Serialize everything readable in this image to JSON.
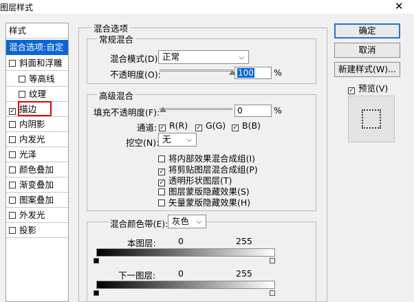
{
  "window": {
    "title": "图层样式",
    "close_glyph": "✕"
  },
  "left_list": [
    {
      "label": "样式",
      "type": "header"
    },
    {
      "label": "混合选项:自定",
      "type": "selected"
    },
    {
      "label": "斜面和浮雕",
      "check": false,
      "indent": false
    },
    {
      "label": "等高线",
      "check": false,
      "indent": true
    },
    {
      "label": "纹理",
      "check": false,
      "indent": true
    },
    {
      "label": "描边",
      "check": true,
      "indent": false
    },
    {
      "label": "内阴影",
      "check": false,
      "indent": false
    },
    {
      "label": "内发光",
      "check": false,
      "indent": false
    },
    {
      "label": "光泽",
      "check": false,
      "indent": false
    },
    {
      "label": "颜色叠加",
      "check": false,
      "indent": false
    },
    {
      "label": "渐变叠加",
      "check": false,
      "indent": false
    },
    {
      "label": "图案叠加",
      "check": false,
      "indent": false
    },
    {
      "label": "外发光",
      "check": false,
      "indent": false
    },
    {
      "label": "投影",
      "check": false,
      "indent": false
    }
  ],
  "blend_options": {
    "title": "混合选项",
    "general": {
      "title": "常规混合",
      "mode_label": "混合模式(D):",
      "mode_value": "正常",
      "opacity_label": "不透明度(O):",
      "opacity_value": "100",
      "opacity_unit": "%",
      "opacity_fraction": 1.0
    },
    "advanced": {
      "title": "高级混合",
      "fill_label": "填充不透明度(F):",
      "fill_value": "0",
      "fill_unit": "%",
      "fill_fraction": 0.0,
      "channels_label": "通道:",
      "channels": [
        {
          "label": "R(R)",
          "checked": true
        },
        {
          "label": "G(G)",
          "checked": true
        },
        {
          "label": "B(B)",
          "checked": true
        }
      ],
      "knockout_label": "挖空(N):",
      "knockout_value": "无",
      "options": [
        {
          "label": "将内部效果混合成组(I)",
          "checked": false
        },
        {
          "label": "将剪贴图层混合成组(P)",
          "checked": true
        },
        {
          "label": "透明形状图层(T)",
          "checked": true
        },
        {
          "label": "图层蒙版隐藏效果(S)",
          "checked": false
        },
        {
          "label": "矢量蒙版隐藏效果(H)",
          "checked": false
        }
      ]
    },
    "blend_if": {
      "label": "混合颜色带(E):",
      "value": "灰色",
      "this_layer_label": "本图层:",
      "this_layer_min": "0",
      "this_layer_max": "255",
      "underlying_label": "下一图层:",
      "underlying_min": "0",
      "underlying_max": "255"
    }
  },
  "buttons": {
    "ok": "确定",
    "cancel": "取消",
    "new_style": "新建样式(W)...",
    "preview_label": "预览(V)",
    "preview_checked": true
  },
  "colors": {
    "selection": "#0a66d8",
    "highlight_border": "#e00000",
    "default_button_border": "#2a6fd6"
  },
  "icons": {
    "close": "close-icon",
    "dropdown": "chevron-down-icon",
    "check": "checkmark-icon",
    "preview": "dotted-selection-icon"
  }
}
